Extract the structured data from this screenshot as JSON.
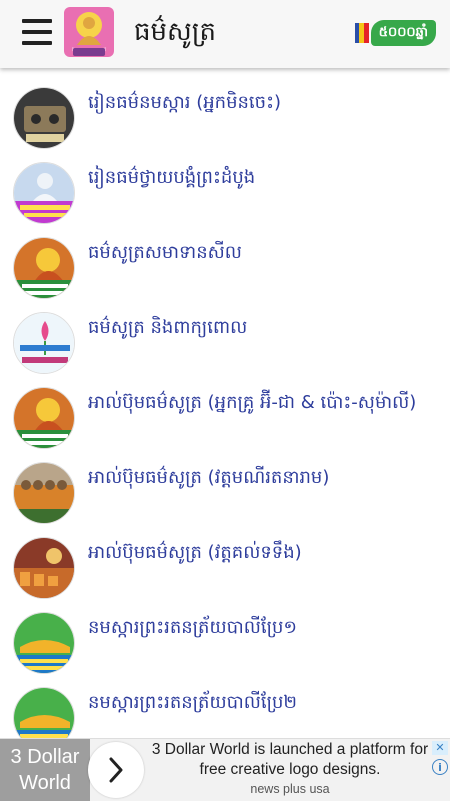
{
  "header": {
    "title": "ធម៌សូត្រ",
    "badge_text": "៥០០០ឆ្នាំ",
    "menu_icon": "hamburger-menu-icon",
    "flag_colors": [
      "#2b4fa8",
      "#f5c518",
      "#e52329"
    ],
    "badge_color": "#37a84a"
  },
  "items": [
    {
      "label": "រៀនធម៌នមស្ការ (អ្នកមិនចេះ)",
      "thumb": "cassette"
    },
    {
      "label": "រៀនធម៌ថ្វាយបង្គំព្រះដំបូង",
      "thumb": "buddha-statue"
    },
    {
      "label": "ធម៌សូត្រសមាទានសីល",
      "thumb": "buddha-red"
    },
    {
      "label": "ធម៌សូត្រ និងពាក្យពោល",
      "thumb": "lotus"
    },
    {
      "label": "អាល់ប៊ុមធម៌សូត្រ (អ្នកគ្រូ អ៊ី-ជា & ប៉ោះ-សុម៉ាលី)",
      "thumb": "buddha-red"
    },
    {
      "label": "អាល់ប៊ុមធម៌សូត្រ (វត្តមណីរតនារាម)",
      "thumb": "monks"
    },
    {
      "label": "អាល់ប៊ុមធម៌សូត្រ (វត្តគល់ទទឹង)",
      "thumb": "ceremony"
    },
    {
      "label": "នមស្ការព្រះរតនត្រ័យបាលីប្រែ១",
      "thumb": "reclining"
    },
    {
      "label": "នមស្ការព្រះរតនត្រ័យបាលីប្រែ២",
      "thumb": "reclining"
    }
  ],
  "ad": {
    "logo_text": "3 Dollar World",
    "headline": "3 Dollar World is launched a platform for free creative logo designs.",
    "source": "news plus usa",
    "info_icon": "info-icon",
    "close_icon": "close-icon"
  }
}
